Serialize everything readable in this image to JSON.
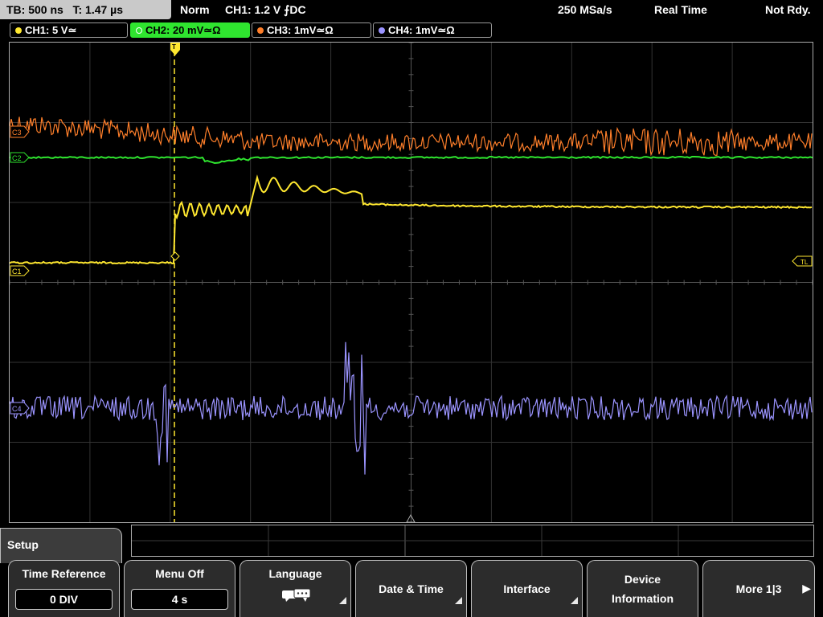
{
  "status_bar": {
    "timebase": "TB: 500 ns",
    "trigger_time": "T: 1.47 µs",
    "trigger_mode": "Norm",
    "trigger_source": "CH1: 1.2 V ⨍DC",
    "sample_rate": "250 MSa/s",
    "acq_mode": "Real Time",
    "run_status": "Not Rdy."
  },
  "channels": [
    {
      "label": "CH1: 5 V≃",
      "color": "#ffe830",
      "active": false
    },
    {
      "label": "CH2: 20 mV≃Ω",
      "color": "#2fe52f",
      "active": true
    },
    {
      "label": "CH3: 1mV≃Ω",
      "color": "#ff7f2a",
      "active": false
    },
    {
      "label": "CH4: 1mV≃Ω",
      "color": "#9b94ff",
      "active": false
    }
  ],
  "screen": {
    "ch3_marker": "C3",
    "ch2_marker": "C2",
    "ch1_marker": "C1",
    "ch4_marker": "C4",
    "trigger_level_marker": "TL",
    "trigger_marker": "T"
  },
  "menu": {
    "title": "Setup",
    "softkeys": [
      {
        "label": "Time Reference",
        "value": "0 DIV"
      },
      {
        "label": "Menu Off",
        "value": "4 s"
      },
      {
        "label": "Language",
        "icon": "speech-bubbles-icon"
      },
      {
        "label": "Date & Time"
      },
      {
        "label": "Interface"
      },
      {
        "label_line1": "Device",
        "label_line2": "Information"
      },
      {
        "label": "More 1|3"
      }
    ]
  }
}
